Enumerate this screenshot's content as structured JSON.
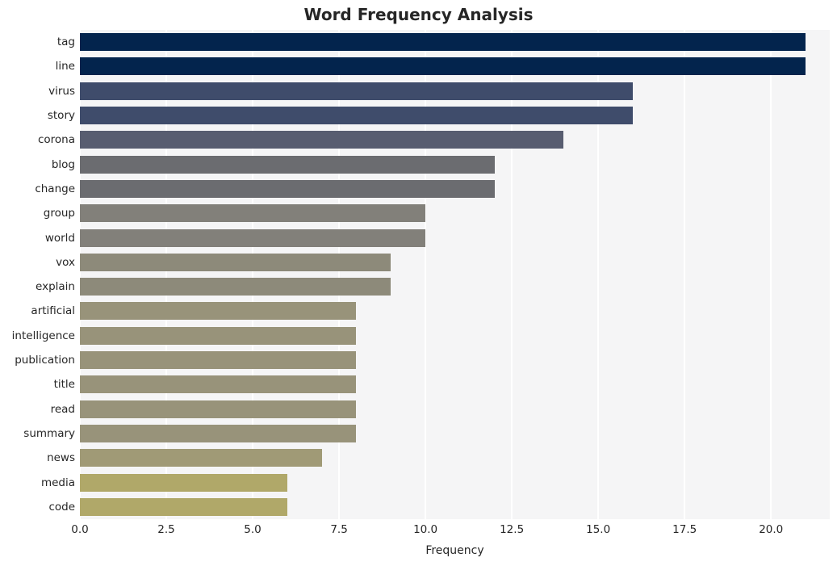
{
  "chart_data": {
    "type": "bar",
    "orientation": "horizontal",
    "title": "Word Frequency Analysis",
    "xlabel": "Frequency",
    "ylabel": "",
    "categories": [
      "tag",
      "line",
      "virus",
      "story",
      "corona",
      "blog",
      "change",
      "group",
      "world",
      "vox",
      "explain",
      "artificial",
      "intelligence",
      "publication",
      "title",
      "read",
      "summary",
      "news",
      "media",
      "code"
    ],
    "values": [
      21,
      21,
      16,
      16,
      14,
      12,
      12,
      10,
      10,
      9,
      9,
      8,
      8,
      8,
      8,
      8,
      8,
      7,
      6,
      6
    ],
    "bar_colors": [
      "#03244d",
      "#03244d",
      "#3f4c6b",
      "#3f4c6b",
      "#585d70",
      "#6b6c70",
      "#6b6c70",
      "#82807a",
      "#82807a",
      "#8d8a7a",
      "#8d8a7a",
      "#98937a",
      "#98937a",
      "#98937a",
      "#98937a",
      "#98937a",
      "#98937a",
      "#a09a76",
      "#b0a869",
      "#b0a869"
    ],
    "xticks": [
      0.0,
      2.5,
      5.0,
      7.5,
      10.0,
      12.5,
      15.0,
      17.5,
      20.0
    ],
    "xtick_labels": [
      "0.0",
      "2.5",
      "5.0",
      "7.5",
      "10.0",
      "12.5",
      "15.0",
      "17.5",
      "20.0"
    ],
    "xlim": [
      0,
      21.7
    ],
    "grid": "vertical-white",
    "legend": null,
    "plot_background": "#f5f5f6",
    "figure_background": "#ffffff",
    "title_color": "#262626"
  }
}
